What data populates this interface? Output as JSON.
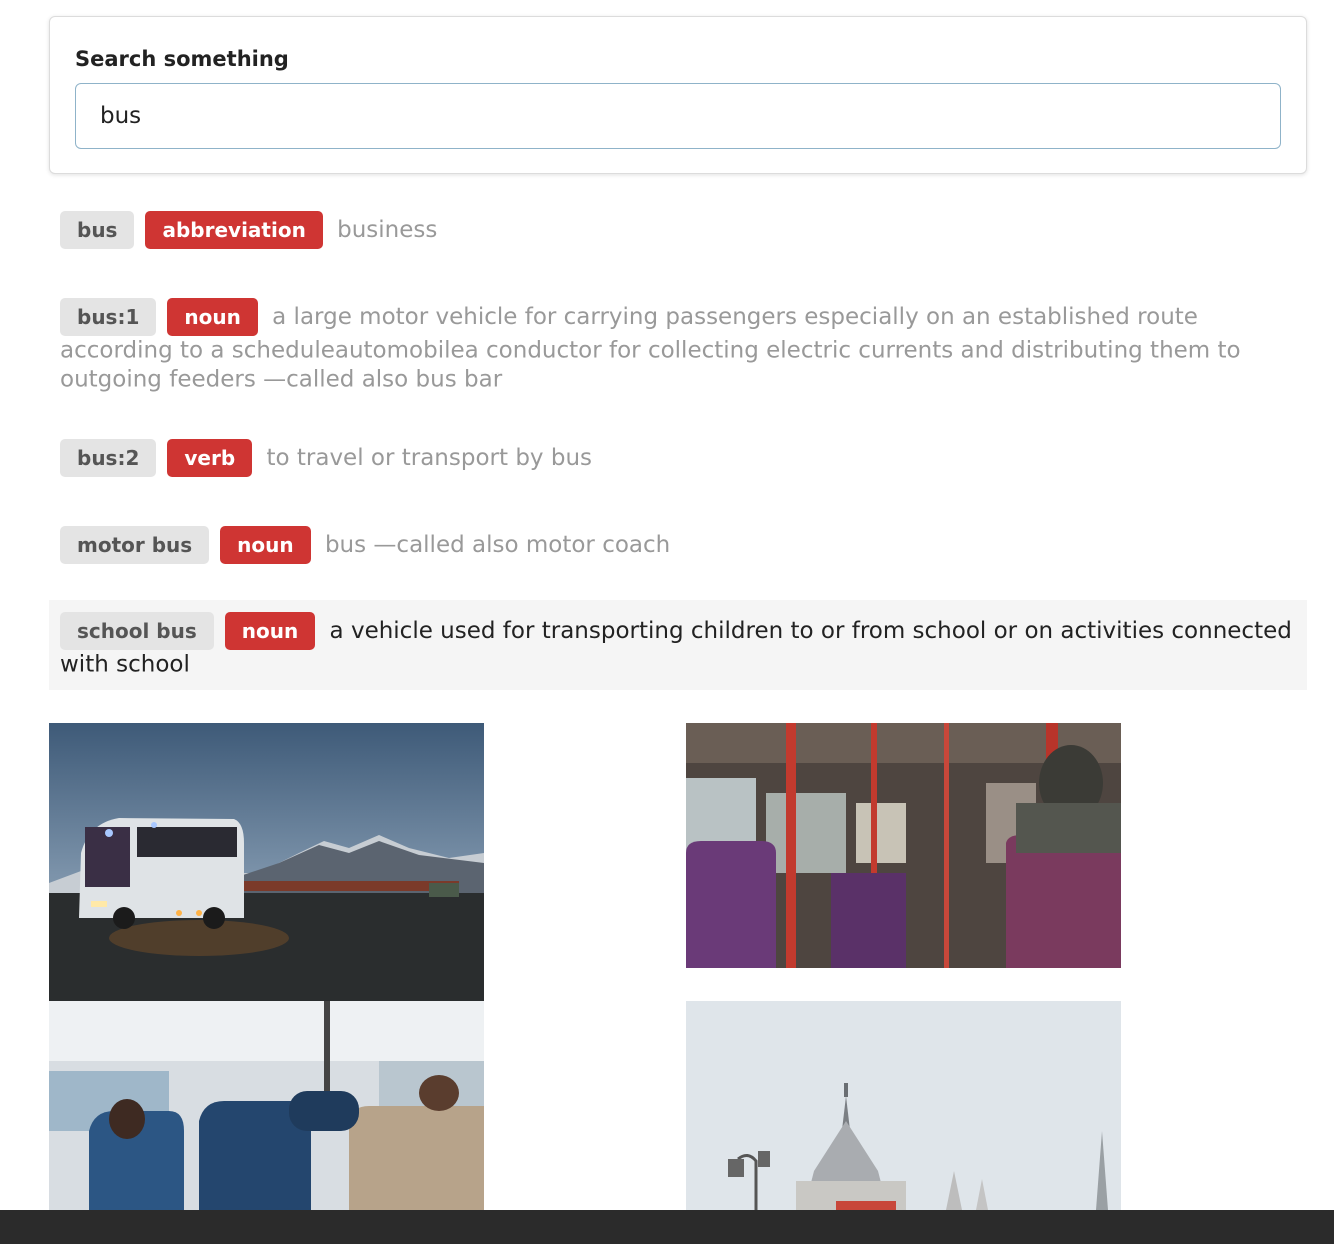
{
  "search": {
    "label": "Search something",
    "value": "bus"
  },
  "entries": [
    {
      "word": "bus",
      "pos": "abbreviation",
      "definition": "business"
    },
    {
      "word": "bus:1",
      "pos": "noun",
      "definition": "a large motor vehicle for carrying passengers especially on an established route according to a scheduleautomobilea conductor for collecting electric currents and distributing them to outgoing feeders —called also bus bar"
    },
    {
      "word": "bus:2",
      "pos": "verb",
      "definition": "to travel or transport by bus"
    },
    {
      "word": "motor bus",
      "pos": "noun",
      "definition": "bus —called also motor coach"
    },
    {
      "word": "school bus",
      "pos": "noun",
      "definition": "a vehicle used for transporting children to or from school or on activities connected with school"
    }
  ],
  "colors": {
    "pos_tag": "#cf3533",
    "word_tag": "#e4e4e4",
    "highlight_row": "#f5f5f5"
  }
}
